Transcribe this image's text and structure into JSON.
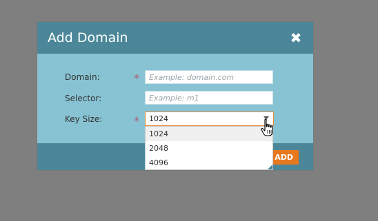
{
  "dialog": {
    "title": "Add Domain",
    "close_icon": "close-icon",
    "fields": {
      "domain": {
        "label": "Domain:",
        "required": "*",
        "value": "",
        "placeholder": "Example: domain.com"
      },
      "selector": {
        "label": "Selector:",
        "value": "",
        "placeholder": "Example: m1"
      },
      "key_size": {
        "label": "Key Size:",
        "required": "*",
        "value": "1024",
        "options": [
          "1024",
          "2048",
          "4096"
        ]
      }
    },
    "footer": {
      "add_label": "ADD"
    }
  },
  "colors": {
    "header": "#4b8799",
    "body": "#87c3d3",
    "accent": "#e8781e",
    "required": "#b05a6b",
    "backdrop": "#7f7f7f"
  }
}
